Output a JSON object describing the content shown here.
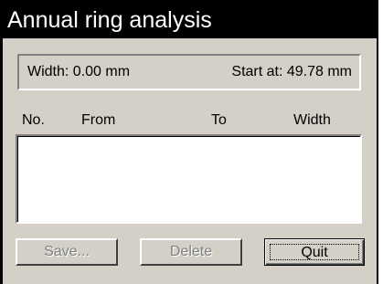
{
  "window": {
    "title": "Annual ring analysis"
  },
  "info": {
    "width_text": "Width: 0.00 mm",
    "start_text": "Start at: 49.78 mm"
  },
  "list": {
    "columns": [
      "No.",
      "From",
      "To",
      "Width"
    ],
    "rows": []
  },
  "buttons": {
    "save_label": "Save...",
    "delete_label": "Delete",
    "quit_label": "Quit"
  },
  "colors": {
    "dialog_background": "#d4d0c8",
    "titlebar_background": "#000000",
    "titlebar_text": "#ffffff",
    "disabled_text": "#808080"
  }
}
